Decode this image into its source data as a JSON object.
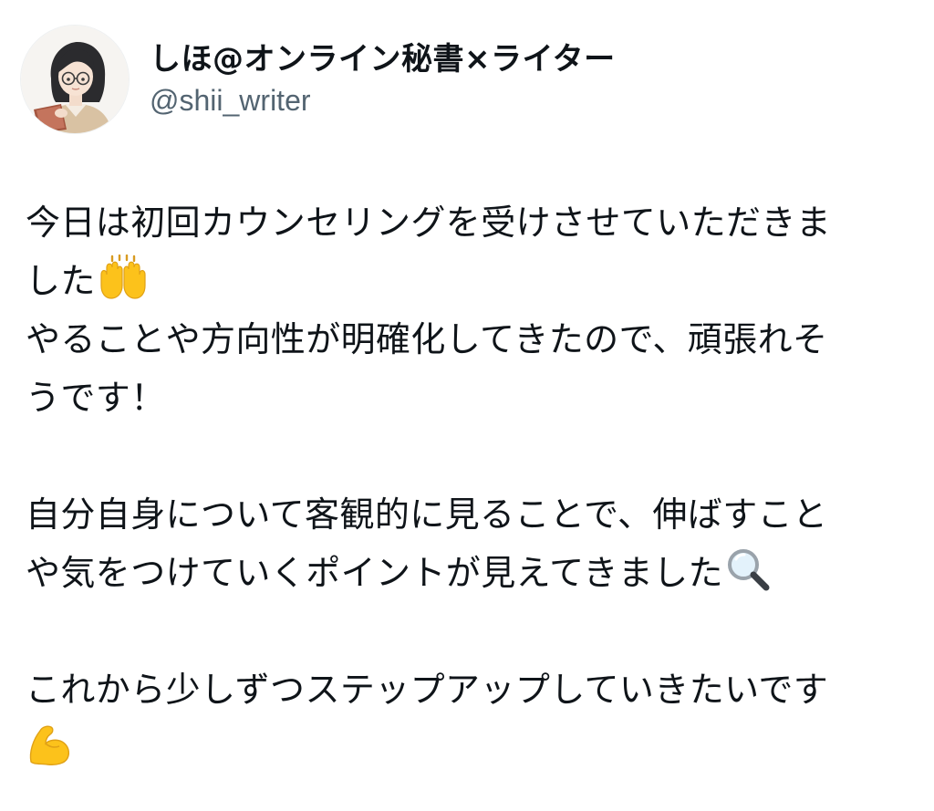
{
  "post": {
    "author": {
      "display_name": "しほ@オンライン秘書×ライター",
      "handle": "@shii_writer",
      "avatar_icon": "avatar-illustration-woman-reading"
    },
    "paragraphs": [
      {
        "lines": [
          "今日は初回カウンセリングを受けさせていただきま",
          "した",
          "やることや方向性が明確化してきたので、頑張れそ",
          "うです！"
        ],
        "emoji_after_line_2": "raising-hands-emoji"
      },
      {
        "lines": [
          "自分自身について客観的に見ることで、伸ばすこと",
          "や気をつけていくポイントが見えてきました"
        ],
        "emoji_after_line_2": "magnifying-glass-emoji"
      },
      {
        "lines": [
          "これから少しずつステップアップしていきたいです"
        ],
        "emoji_line": "flexed-biceps-emoji"
      }
    ]
  }
}
